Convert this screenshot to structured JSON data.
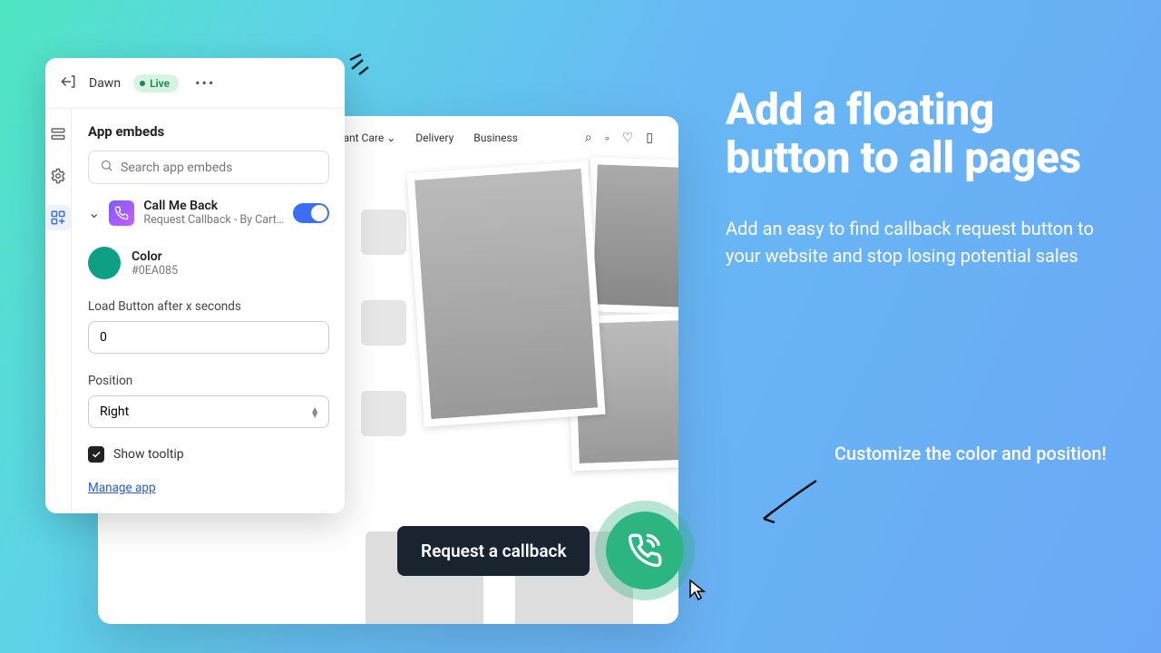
{
  "marketing": {
    "headline": "Add a floating button to all pages",
    "subhead": "Add an easy to find callback request button to your website and stop losing potential sales",
    "callout": "Customize the color and position!"
  },
  "preview": {
    "nav": {
      "plant_care": "Plant Care",
      "delivery": "Delivery",
      "business": "Business"
    },
    "tooltip": "Request a callback"
  },
  "panel": {
    "theme": "Dawn",
    "status": "Live",
    "section_title": "App embeds",
    "search_placeholder": "Search app embeds",
    "embed": {
      "title": "Call Me Back",
      "subtitle": "Request Callback - By Cart…"
    },
    "color": {
      "label": "Color",
      "hex": "#0EA085"
    },
    "load_label": "Load Button after x seconds",
    "load_value": "0",
    "position_label": "Position",
    "position_value": "Right",
    "show_tooltip_label": "Show tooltip",
    "manage_link": "Manage app"
  }
}
